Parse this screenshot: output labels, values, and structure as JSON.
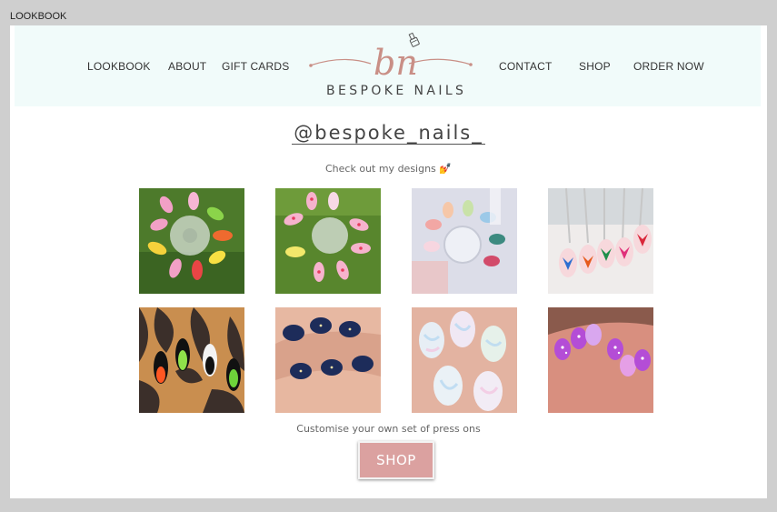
{
  "window": {
    "title": "LOOKBOOK"
  },
  "nav": {
    "left": [
      "LOOKBOOK",
      "ABOUT",
      "GIFT CARDS"
    ],
    "right": [
      "CONTACT",
      "SHOP",
      "ORDER NOW"
    ]
  },
  "logo": {
    "monogram": "bn",
    "brand": "BESPOKE NAILS"
  },
  "gallery": {
    "handle": "@bespoke_nails_",
    "subtitle": "Check out my designs",
    "subtitle_emoji": "💅",
    "images": [
      "nail-wheel-neon-flames",
      "nail-wheel-pink-polka-dots",
      "nail-wheel-pastel-swatches",
      "nail-tips-butterflies",
      "nail-tips-neon-flames",
      "navy-starry-nails",
      "pastel-marble-nails",
      "purple-polka-dot-nails"
    ]
  },
  "cta": {
    "text": "Customise your own set of press ons",
    "button": "SHOP"
  },
  "colors": {
    "header_bg": "#f1fbfa",
    "accent": "#dba1a0",
    "logo_rose": "#c98f86"
  }
}
